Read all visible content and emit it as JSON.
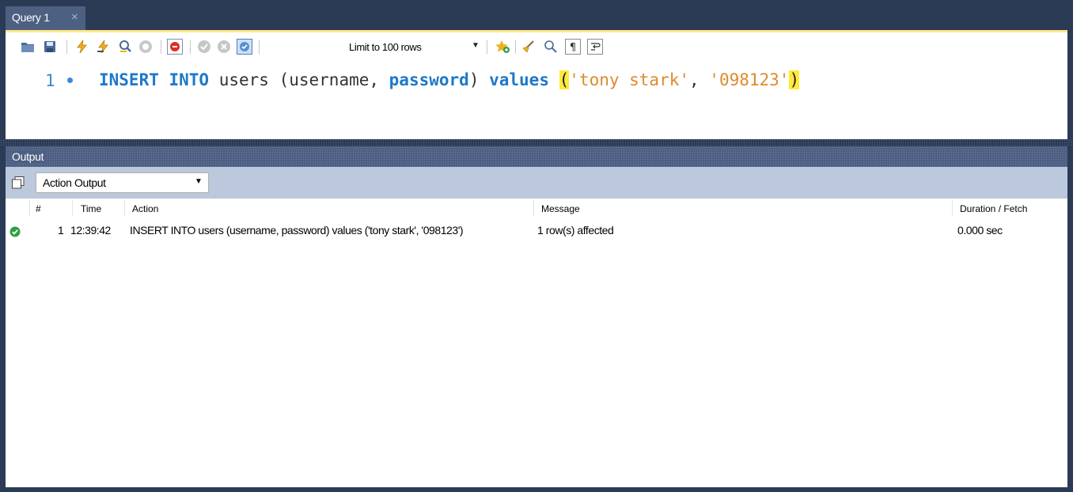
{
  "tab": {
    "title": "Query 1",
    "close": "×"
  },
  "toolbar": {
    "limit_label": "Limit to 100 rows",
    "icons": [
      "open-folder-icon",
      "save-icon",
      "execute-icon",
      "execute-current-icon",
      "explain-icon",
      "stop-icon",
      "toggle-error-icon",
      "commit-icon",
      "rollback-icon",
      "autocommit-icon",
      "bookmark-star-icon",
      "beautify-icon",
      "find-icon",
      "invisible-chars-icon",
      "wrap-lines-icon"
    ]
  },
  "editor": {
    "line_number": "1",
    "tokens": {
      "kw1": "INSERT INTO",
      "p1": " users (username, ",
      "kw2": "password",
      "p2": ") ",
      "kw3": "values",
      "sp": " ",
      "lparen": "(",
      "s1": "'tony stark'",
      "comma": ", ",
      "s2": "'098123'",
      "rparen": ")"
    }
  },
  "output": {
    "title": "Output",
    "selector_value": "Action Output",
    "columns": {
      "num": "#",
      "time": "Time",
      "action": "Action",
      "message": "Message",
      "duration": "Duration / Fetch"
    },
    "rows": [
      {
        "status": "success",
        "num": "1",
        "time": "12:39:42",
        "action": "INSERT INTO users (username, password) values ('tony stark', '098123')",
        "message": "1 row(s) affected",
        "duration": "0.000 sec"
      }
    ]
  },
  "colors": {
    "frame": "#2b3a55",
    "tab": "#4d6082",
    "keyword": "#1e78c8",
    "string": "#e08a2c",
    "highlight": "#ffea3a",
    "success": "#2ea043"
  }
}
